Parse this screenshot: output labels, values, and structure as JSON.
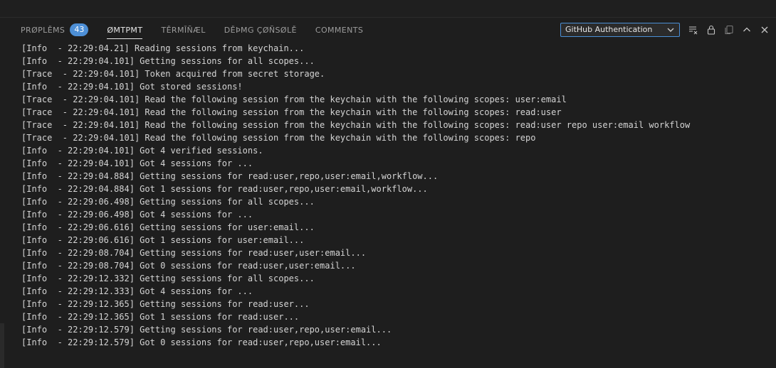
{
  "panel": {
    "tabs": [
      {
        "label": "PRØPLĚMS",
        "badge": "43",
        "active": false
      },
      {
        "label": "ØMTPMT",
        "active": true
      },
      {
        "label": "TĚRMĪÑÆL",
        "active": false
      },
      {
        "label": "DĚÞMG ÇØÑSØLĚ",
        "active": false
      },
      {
        "label": "COMMENTS",
        "active": false
      }
    ],
    "channel_select": {
      "value": "GitHub Authentication"
    },
    "icons": [
      "clear-output-icon",
      "lock-scroll-icon",
      "copy-icon",
      "chevron-up-icon",
      "close-icon"
    ],
    "colors": {
      "accent": "#4d8fd6",
      "background": "#1e1e1e",
      "text": "#d4d4d4"
    }
  },
  "output": {
    "lines": [
      "[Info  - 22:29:04.21] Reading sessions from keychain...",
      "[Info  - 22:29:04.101] Getting sessions for all scopes...",
      "[Trace  - 22:29:04.101] Token acquired from secret storage.",
      "[Info  - 22:29:04.101] Got stored sessions!",
      "[Trace  - 22:29:04.101] Read the following session from the keychain with the following scopes: user:email",
      "[Trace  - 22:29:04.101] Read the following session from the keychain with the following scopes: read:user",
      "[Trace  - 22:29:04.101] Read the following session from the keychain with the following scopes: read:user repo user:email workflow",
      "[Trace  - 22:29:04.101] Read the following session from the keychain with the following scopes: repo",
      "[Info  - 22:29:04.101] Got 4 verified sessions.",
      "[Info  - 22:29:04.101] Got 4 sessions for ...",
      "[Info  - 22:29:04.884] Getting sessions for read:user,repo,user:email,workflow...",
      "[Info  - 22:29:04.884] Got 1 sessions for read:user,repo,user:email,workflow...",
      "[Info  - 22:29:06.498] Getting sessions for all scopes...",
      "[Info  - 22:29:06.498] Got 4 sessions for ...",
      "[Info  - 22:29:06.616] Getting sessions for user:email...",
      "[Info  - 22:29:06.616] Got 1 sessions for user:email...",
      "[Info  - 22:29:08.704] Getting sessions for read:user,user:email...",
      "[Info  - 22:29:08.704] Got 0 sessions for read:user,user:email...",
      "[Info  - 22:29:12.332] Getting sessions for all scopes...",
      "[Info  - 22:29:12.333] Got 4 sessions for ...",
      "[Info  - 22:29:12.365] Getting sessions for read:user...",
      "[Info  - 22:29:12.365] Got 1 sessions for read:user...",
      "[Info  - 22:29:12.579] Getting sessions for read:user,repo,user:email...",
      "[Info  - 22:29:12.579] Got 0 sessions for read:user,repo,user:email..."
    ]
  }
}
